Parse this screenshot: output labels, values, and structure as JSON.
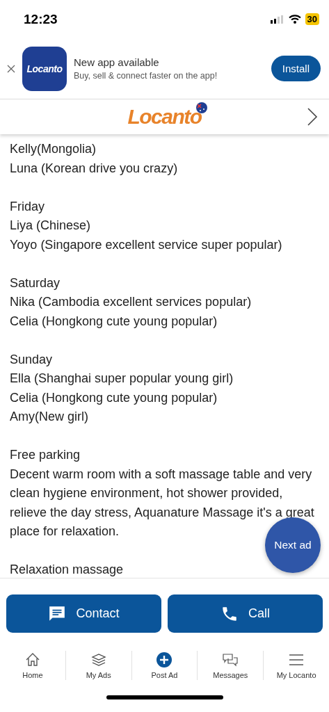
{
  "status_bar": {
    "time": "12:23",
    "battery": "30"
  },
  "app_banner": {
    "title": "New app available",
    "subtitle": "Buy, sell & connect faster on the app!",
    "app_name": "Locanto",
    "button": "Install"
  },
  "header": {
    "logo": "Locanto"
  },
  "description": [
    {
      "lines": [
        "Kelly(Mongolia)",
        "Luna (Korean drive you crazy)"
      ]
    },
    {
      "lines": [
        "Friday",
        "Liya (Chinese)",
        "Yoyo (Singapore excellent service super popular)"
      ]
    },
    {
      "lines": [
        "Saturday",
        "Nika (Cambodia excellent services popular)",
        "Celia (Hongkong cute young popular)"
      ]
    },
    {
      "lines": [
        "Sunday",
        "Ella (Shanghai super popular young girl)",
        "Celia (Hongkong cute young popular)",
        "Amy(New girl)"
      ]
    },
    {
      "lines": [
        "Free parking",
        "Decent warm room with a soft massage table and very clean hygiene environment, hot shower provided, relieve the day stress, Aquanature Massage it's a great place for relaxation."
      ]
    },
    {
      "lines": [
        "Relaxation massage"
      ]
    }
  ],
  "next_ad": "Next ad",
  "actions": [
    {
      "kind": "contact",
      "label": "Contact"
    },
    {
      "kind": "call",
      "label": "Call"
    }
  ],
  "nav": [
    {
      "kind": "home",
      "label": "Home"
    },
    {
      "kind": "ads",
      "label": "My Ads"
    },
    {
      "kind": "post",
      "label": "Post Ad"
    },
    {
      "kind": "messages",
      "label": "Messages"
    },
    {
      "kind": "menu",
      "label": "My Locanto"
    }
  ]
}
